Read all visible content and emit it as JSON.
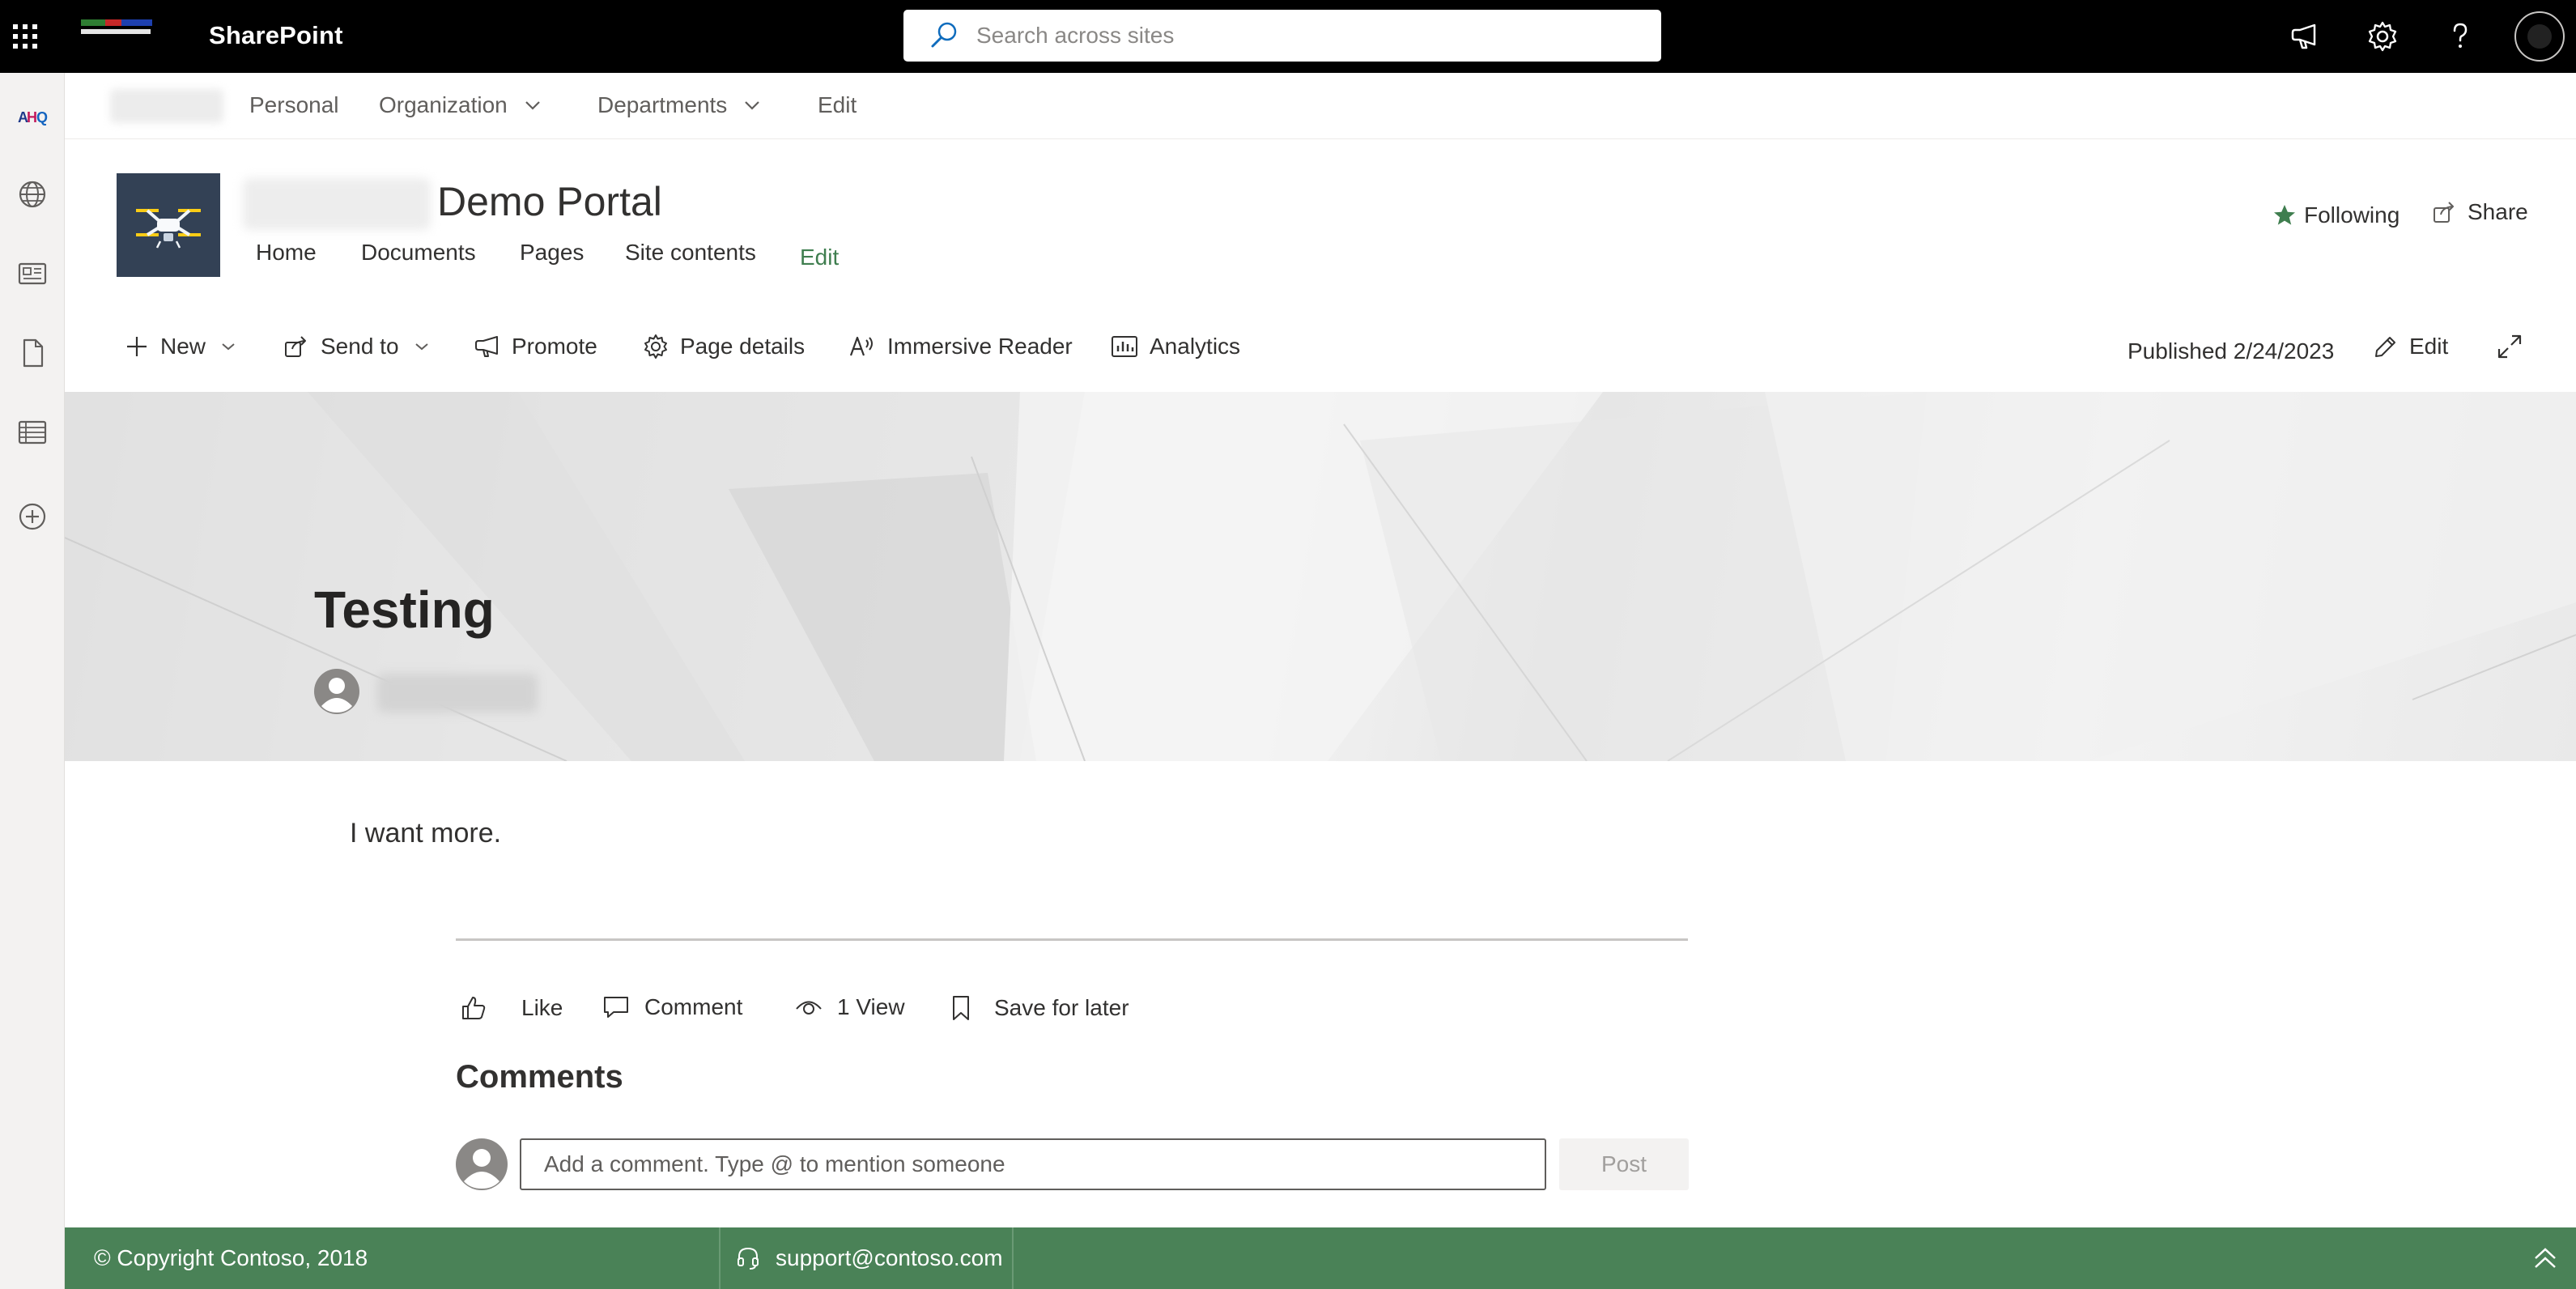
{
  "suite_bar": {
    "app_name": "SharePoint",
    "search_placeholder": "Search across sites"
  },
  "hub_nav": {
    "items": [
      "Personal",
      "Organization",
      "Departments",
      "Edit"
    ]
  },
  "site": {
    "title": "Demo Portal",
    "nav": [
      "Home",
      "Documents",
      "Pages",
      "Site contents"
    ],
    "nav_edit": "Edit",
    "following": "Following",
    "share": "Share"
  },
  "command_bar": {
    "new": "New",
    "send_to": "Send to",
    "promote": "Promote",
    "page_details": "Page details",
    "immersive_reader": "Immersive Reader",
    "analytics": "Analytics",
    "published": "Published 2/24/2023",
    "edit": "Edit"
  },
  "page": {
    "title": "Testing",
    "body": "I want more."
  },
  "social_bar": {
    "like": "Like",
    "comment": "Comment",
    "views": "1 View",
    "save_for_later": "Save for later"
  },
  "comments": {
    "heading": "Comments",
    "placeholder": "Add a comment. Type @ to mention someone",
    "post": "Post"
  },
  "footer": {
    "copyright": "© Copyright Contoso, 2018",
    "support": "support@contoso.com"
  },
  "colors": {
    "suite_bar": "#000000",
    "footer": "#4a8257",
    "accent_green": "#3f7e4f",
    "logo_bg": "#334155"
  },
  "icons": [
    "waffle-icon",
    "megaphone-icon",
    "gear-icon",
    "help-icon",
    "search-icon",
    "star-icon",
    "share-icon",
    "plus-icon",
    "chevron-down-icon",
    "send-icon",
    "megaphone-icon",
    "gear-icon",
    "immersive-reader-icon",
    "analytics-icon",
    "pencil-icon",
    "expand-icon",
    "like-icon",
    "comment-icon",
    "eye-icon",
    "bookmark-icon",
    "headset-icon",
    "chevron-up-double-icon"
  ]
}
